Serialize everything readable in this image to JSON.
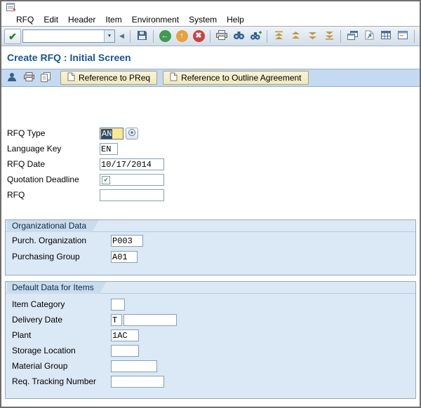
{
  "menu": {
    "items": [
      {
        "label": "RFQ"
      },
      {
        "label": "Edit"
      },
      {
        "label": "Header"
      },
      {
        "label": "Item"
      },
      {
        "label": "Environment"
      },
      {
        "label": "System"
      },
      {
        "label": "Help"
      }
    ]
  },
  "icons": {
    "enter": "✔",
    "command_dropdown": "▼",
    "command_collapse": "◀",
    "back": "←",
    "exit": "↑",
    "cancel": "✖",
    "help": "?",
    "mandatory": "✔"
  },
  "toolbar": {
    "command_field": {
      "value": ""
    }
  },
  "page": {
    "title": "Create RFQ : Initial Screen"
  },
  "app_toolbar": {
    "buttons": [
      {
        "label": "Reference to PReq"
      },
      {
        "label": "Reference to Outline Agreement"
      }
    ]
  },
  "form": {
    "rfq_type": {
      "label": "RFQ Type",
      "value": "AN"
    },
    "language_key": {
      "label": "Language Key",
      "value": "EN"
    },
    "rfq_date": {
      "label": "RFQ Date",
      "value": "10/17/2014"
    },
    "quotation_deadline": {
      "label": "Quotation Deadline",
      "value": ""
    },
    "rfq": {
      "label": "RFQ",
      "value": ""
    }
  },
  "org_data": {
    "title": "Organizational Data",
    "purch_organization": {
      "label": "Purch. Organization",
      "value": "P003"
    },
    "purchasing_group": {
      "label": "Purchasing Group",
      "value": "A01"
    }
  },
  "default_data": {
    "title": "Default Data for Items",
    "item_category": {
      "label": "Item Category",
      "value": ""
    },
    "delivery_date": {
      "label": "Delivery Date",
      "value": "T",
      "value2": ""
    },
    "plant": {
      "label": "Plant",
      "value": "1AC"
    },
    "storage_location": {
      "label": "Storage Location",
      "value": ""
    },
    "material_group": {
      "label": "Material Group",
      "value": ""
    },
    "req_tracking_number": {
      "label": "Req. Tracking Number",
      "value": ""
    }
  },
  "colors": {
    "title_text": "#15549a",
    "group_bg": "#dbe8f5",
    "group_border": "#91a9c2",
    "focus_field_bg": "#fce98e",
    "selection_bg": "#2e4d6e",
    "app_toolbar_bg": "#c4daf0",
    "reference_button_bg": "#f3eecb"
  }
}
